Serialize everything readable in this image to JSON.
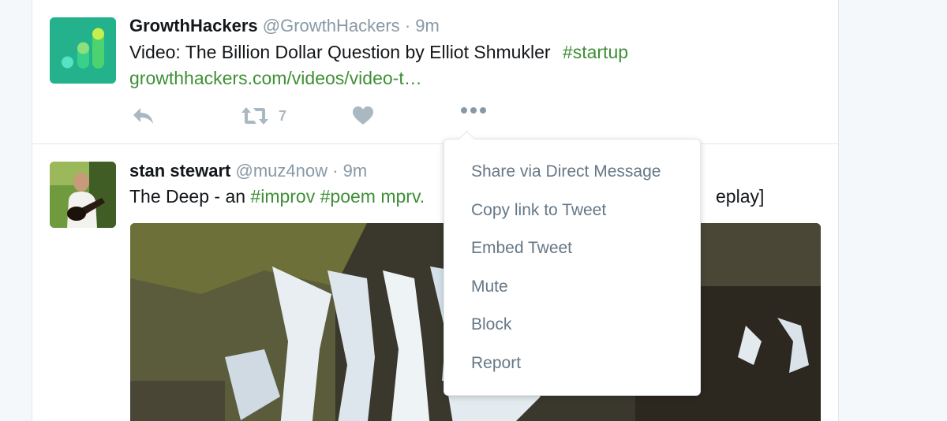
{
  "tweets": [
    {
      "fullname": "GrowthHackers",
      "handle": "@GrowthHackers",
      "separator": "·",
      "time": "9m",
      "text": "Video: The Billion Dollar Question by Elliot Shmukler",
      "hashtag": "#startup",
      "link": "growthhackers.com/videos/video-t…",
      "retweet_count": "7"
    },
    {
      "fullname": "stan stewart",
      "handle": "@muz4now",
      "separator": "·",
      "time": "9m",
      "text_before": "The Deep - an ",
      "hashtag1": "#improv",
      "hashtag2": "#poem",
      "link": "mprv.",
      "text_after": "eplay]"
    }
  ],
  "menu": {
    "items": [
      "Share via Direct Message",
      "Copy link to Tweet",
      "Embed Tweet",
      "Mute",
      "Block",
      "Report"
    ]
  },
  "colors": {
    "accent_link": "#3f8f36",
    "muted": "#8899a6",
    "icon": "#aab8c2",
    "menu_text": "#657786"
  },
  "icons": [
    "reply-icon",
    "retweet-icon",
    "like-icon",
    "more-icon"
  ]
}
